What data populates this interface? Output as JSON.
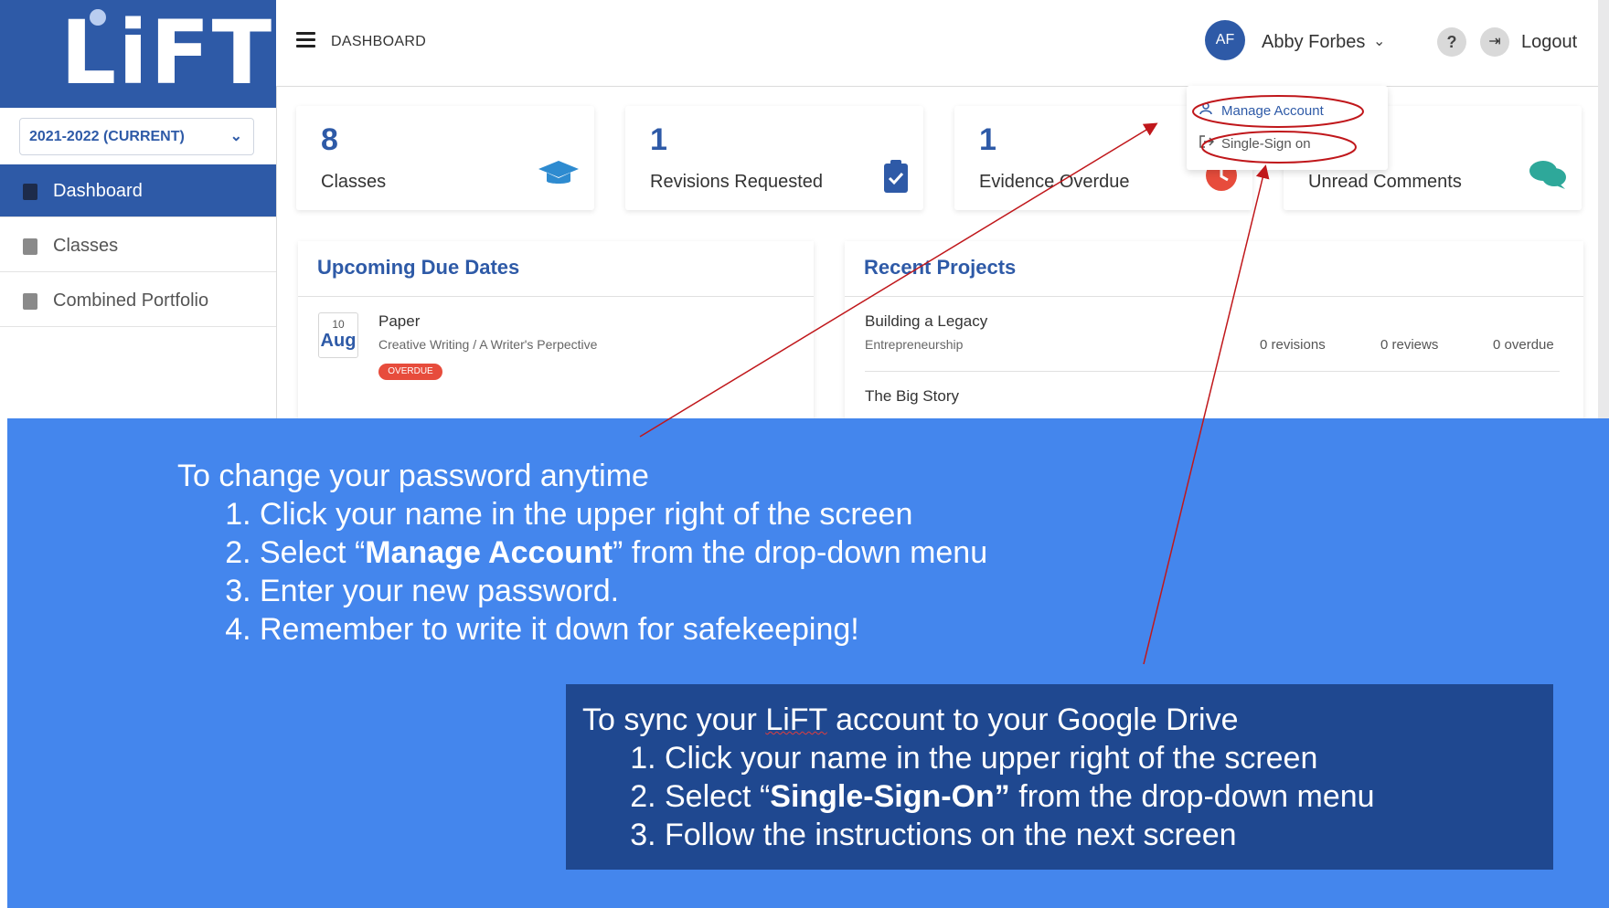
{
  "app": {
    "logo": "LiFT",
    "year_select": "2021-2022 (CURRENT)"
  },
  "sidebar": {
    "items": [
      {
        "label": "Dashboard",
        "icon": "dashboard-icon",
        "active": true
      },
      {
        "label": "Classes",
        "icon": "book-icon",
        "active": false
      },
      {
        "label": "Combined Portfolio",
        "icon": "portfolio-icon",
        "active": false
      }
    ]
  },
  "topbar": {
    "breadcrumb": "DASHBOARD",
    "avatar_initials": "AF",
    "user_name": "Abby Forbes",
    "help": "?",
    "logout_label": "Logout"
  },
  "stats": [
    {
      "value": "8",
      "label": "Classes",
      "icon": "graduation-cap-icon"
    },
    {
      "value": "1",
      "label": "Revisions Requested",
      "icon": "clipboard-check-icon"
    },
    {
      "value": "1",
      "label": "Evidence Overdue",
      "icon": "clock-icon"
    },
    {
      "value": "",
      "label": "Unread Comments",
      "icon": "comments-icon"
    }
  ],
  "upcoming": {
    "title": "Upcoming Due Dates",
    "items": [
      {
        "day": "10",
        "month": "Aug",
        "title": "Paper",
        "subtitle": "Creative Writing / A Writer's Perpective",
        "badge": "OVERDUE"
      }
    ]
  },
  "recent": {
    "title": "Recent Projects",
    "items": [
      {
        "title": "Building a Legacy",
        "subtitle": "Entrepreneurship",
        "revisions": "0 revisions",
        "reviews": "0 reviews",
        "overdue": "0 overdue"
      },
      {
        "title": "The Big Story"
      }
    ]
  },
  "dropdown": {
    "items": [
      {
        "label": "Manage Account",
        "icon": "user-icon"
      },
      {
        "label": "Single-Sign on",
        "icon": "sign-in-icon"
      }
    ]
  },
  "instructions": {
    "password": {
      "heading": "To change your password anytime",
      "steps": [
        "Click your name in the upper right of the screen",
        "from the drop-down menu",
        "Enter your new password.",
        "Remember to write it down for safekeeping!"
      ],
      "step2_prefix": "Select “",
      "step2_bold": "Manage Account",
      "step2_suffix": "” from the drop-down menu"
    },
    "sync": {
      "heading_pre": "To sync your ",
      "heading_brand": "LiFT",
      "heading_post": " account to your Google Drive",
      "step1": "Click your name in the upper right of the screen",
      "step2_prefix": "Select “",
      "step2_bold": "Single-Sign-On”",
      "step2_suffix": " from the drop-down menu",
      "step3": "Follow the instructions on the next screen"
    }
  },
  "colors": {
    "brand_blue": "#2e5aa7",
    "overlay_blue": "#4486ed",
    "overlay_dark": "#1f4890",
    "annotation_red": "#c0171b",
    "overdue_red": "#e74c3c"
  }
}
